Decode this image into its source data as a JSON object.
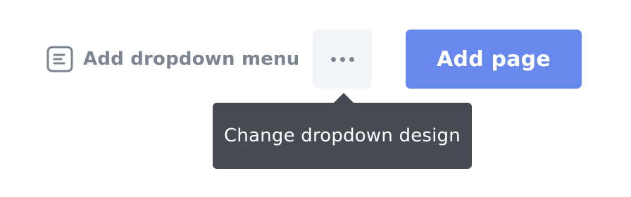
{
  "toolbar": {
    "add_dropdown": {
      "label": "Add dropdown menu",
      "icon": "list-icon"
    },
    "more_button": {
      "icon": "more-dots-icon"
    },
    "add_page_button": {
      "label": "Add page",
      "background_color": "#6788ec"
    }
  },
  "tooltip": {
    "text": "Change dropdown design",
    "background_color": "#464a52"
  }
}
